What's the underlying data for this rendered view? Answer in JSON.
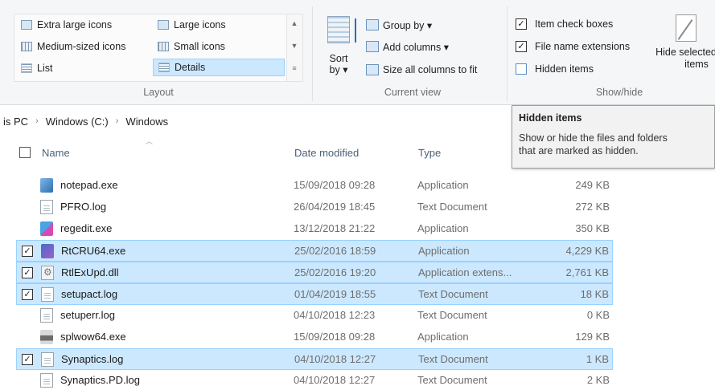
{
  "ribbon": {
    "layout": {
      "group_label": "Layout",
      "items": [
        {
          "label": "Extra large icons",
          "icon": "extra-large-icons-icon"
        },
        {
          "label": "Large icons",
          "icon": "large-icons-icon"
        },
        {
          "label": "Medium-sized icons",
          "icon": "medium-icons-icon"
        },
        {
          "label": "Small icons",
          "icon": "small-icons-icon"
        },
        {
          "label": "List",
          "icon": "list-icon"
        },
        {
          "label": "Details",
          "icon": "details-icon",
          "selected": true
        }
      ]
    },
    "current_view": {
      "group_label": "Current view",
      "sort_label_1": "Sort",
      "sort_label_2": "by ▾",
      "group_by": "Group by ▾",
      "add_columns": "Add columns ▾",
      "size_all": "Size all columns to fit"
    },
    "show_hide": {
      "group_label": "Show/hide",
      "item_check_boxes": {
        "label": "Item check boxes",
        "checked": true
      },
      "file_name_extensions": {
        "label": "File name extensions",
        "checked": true
      },
      "hidden_items": {
        "label": "Hidden items",
        "checked": false
      },
      "hide_selected_1": "Hide selected",
      "hide_selected_2": "items"
    }
  },
  "address": {
    "crumbs": [
      "is PC",
      "Windows (C:)",
      "Windows"
    ]
  },
  "tooltip": {
    "title": "Hidden items",
    "text_1": "Show or hide the files and folders",
    "text_2": "that are marked as hidden."
  },
  "columns": {
    "name": "Name",
    "date_modified": "Date modified",
    "type": "Type"
  },
  "files": [
    {
      "name": "notepad.exe",
      "date": "15/09/2018 09:28",
      "type": "Application",
      "size": "249 KB",
      "selected": false,
      "icon": "exe"
    },
    {
      "name": "PFRO.log",
      "date": "26/04/2019 18:45",
      "type": "Text Document",
      "size": "272 KB",
      "selected": false,
      "icon": "doc"
    },
    {
      "name": "regedit.exe",
      "date": "13/12/2018 21:22",
      "type": "Application",
      "size": "350 KB",
      "selected": false,
      "icon": "reg"
    },
    {
      "name": "RtCRU64.exe",
      "date": "25/02/2016 18:59",
      "type": "Application",
      "size": "4,229 KB",
      "selected": true,
      "icon": "rt"
    },
    {
      "name": "RtlExUpd.dll",
      "date": "25/02/2016 19:20",
      "type": "Application extens...",
      "size": "2,761 KB",
      "selected": true,
      "icon": "dll"
    },
    {
      "name": "setupact.log",
      "date": "01/04/2019 18:55",
      "type": "Text Document",
      "size": "18 KB",
      "selected": true,
      "icon": "doc"
    },
    {
      "name": "setuperr.log",
      "date": "04/10/2018 12:23",
      "type": "Text Document",
      "size": "0 KB",
      "selected": false,
      "icon": "doc"
    },
    {
      "name": "splwow64.exe",
      "date": "15/09/2018 09:28",
      "type": "Application",
      "size": "129 KB",
      "selected": false,
      "icon": "print"
    },
    {
      "name": "Synaptics.log",
      "date": "04/10/2018 12:27",
      "type": "Text Document",
      "size": "1 KB",
      "selected": true,
      "icon": "doc"
    },
    {
      "name": "Synaptics.PD.log",
      "date": "04/10/2018 12:27",
      "type": "Text Document",
      "size": "2 KB",
      "selected": false,
      "icon": "doc"
    }
  ],
  "checkmark": "✓"
}
